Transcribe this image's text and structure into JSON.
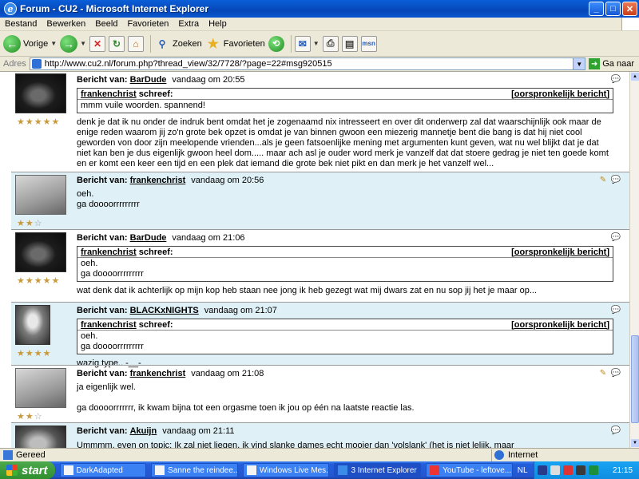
{
  "window": {
    "title": "Forum - CU2 - Microsoft Internet Explorer",
    "min": "_",
    "max": "□",
    "close": "✕"
  },
  "menu": [
    "Bestand",
    "Bewerken",
    "Beeld",
    "Favorieten",
    "Extra",
    "Help"
  ],
  "toolbar": {
    "back": "Vorige",
    "search": "Zoeken",
    "favorites": "Favorieten"
  },
  "address": {
    "label": "Adres",
    "url": "http://www.cu2.nl/forum.php?thread_view/32/7728/?page=22#msg920515",
    "go": "Ga naar"
  },
  "posts": [
    {
      "label": "Bericht van:",
      "author": "BarDude",
      "time": "vandaag om 20:55",
      "stars": 5,
      "stars_max": 5,
      "editable": false,
      "quote": {
        "author": "frankenchrist",
        "said": "schreef:",
        "orig": "[oorspronkelijk bericht]",
        "text": "mmm vuile woorden. spannend!"
      },
      "message": "denk je dat ik nu onder de indruk bent omdat het je zogenaamd nix intresseert en over dit onderwerp zal dat waarschijnlijk ook maar de enige reden waarom jij zo'n grote bek opzet is omdat je van binnen gwoon een miezerig mannetje bent die bang is dat hij niet cool geworden von door zijn meelopende vrienden...als je geen fatsoenlijke mening met argumenten kunt geven, wat nu wel blijkt dat je dat niet kan ben je dus eigenlijk gwoon heel dom..... maar ach asl je ouder word merk je vanzelf dat dat stoere gedrag je niet ten goede komt en er komt een keer een tijd en een plek dat iemand die grote bek niet pikt en dan merk je het vanzelf wel..."
    },
    {
      "label": "Bericht van:",
      "author": "frankenchrist",
      "time": "vandaag om 20:56",
      "stars": 2,
      "stars_max": 3,
      "editable": true,
      "message": "oeh.\nga doooorrrrrrrrr"
    },
    {
      "label": "Bericht van:",
      "author": "BarDude",
      "time": "vandaag om 21:06",
      "stars": 5,
      "stars_max": 5,
      "editable": false,
      "quote": {
        "author": "frankenchrist",
        "said": "schreef:",
        "orig": "[oorspronkelijk bericht]",
        "text": "oeh.\nga doooorrrrrrrrr"
      },
      "message": "wat denk dat ik achterlijk op mijn kop heb staan nee jong ik heb gezegt wat mij dwars zat en nu sop jij het je maar op..."
    },
    {
      "label": "Bericht van:",
      "author": "BLACKxNIGHTS",
      "time": "vandaag om 21:07",
      "stars": 4,
      "stars_max": 4,
      "editable": false,
      "quote": {
        "author": "frankenchrist",
        "said": "schreef:",
        "orig": "[oorspronkelijk bericht]",
        "text": "oeh.\nga doooorrrrrrrrr"
      },
      "message": "wazig type.. -__-"
    },
    {
      "label": "Bericht van:",
      "author": "frankenchrist",
      "time": "vandaag om 21:08",
      "stars": 2,
      "stars_max": 3,
      "editable": true,
      "message": "ja eigenlijk wel.\n\nga doooorrrrrrr, ik kwam bijna tot een orgasme toen ik jou op één na laatste reactie las."
    },
    {
      "label": "Bericht van:",
      "author": "Akuijn",
      "time": "vandaag om 21:11",
      "stars": 0,
      "stars_max": 0,
      "editable": false,
      "message": "Ummmm, even on topic: Ik zal niet liegen, ik vind slanke dames echt mooier dan 'volslank' (het is niet lelijk, maar"
    }
  ],
  "status": {
    "text": "Gereed",
    "zone": "Internet"
  },
  "taskbar": {
    "start": "start",
    "tasks": [
      "DarkAdapted",
      "Sanne the reindee...",
      "Windows Live Mes...",
      "3 Internet Explorer",
      "YouTube - leftove..."
    ],
    "lang": "NL",
    "clock": "21:15"
  }
}
